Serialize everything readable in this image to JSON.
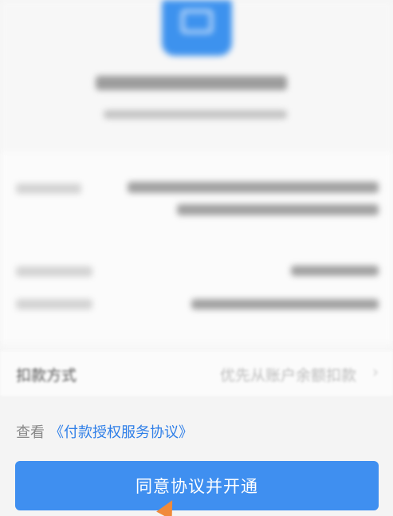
{
  "header": {
    "app_icon": "blue-app-icon"
  },
  "deduction": {
    "label": "扣款方式",
    "value": "优先从账户余额扣款",
    "chevron": "›"
  },
  "agreement": {
    "prefix": "查看",
    "link_text": "《付款授权服务协议》"
  },
  "confirm_button": {
    "label": "同意协议并开通",
    "color": "#3f8ff0"
  },
  "colors": {
    "link": "#2f7fe8",
    "cursor": "#f08a3a"
  }
}
